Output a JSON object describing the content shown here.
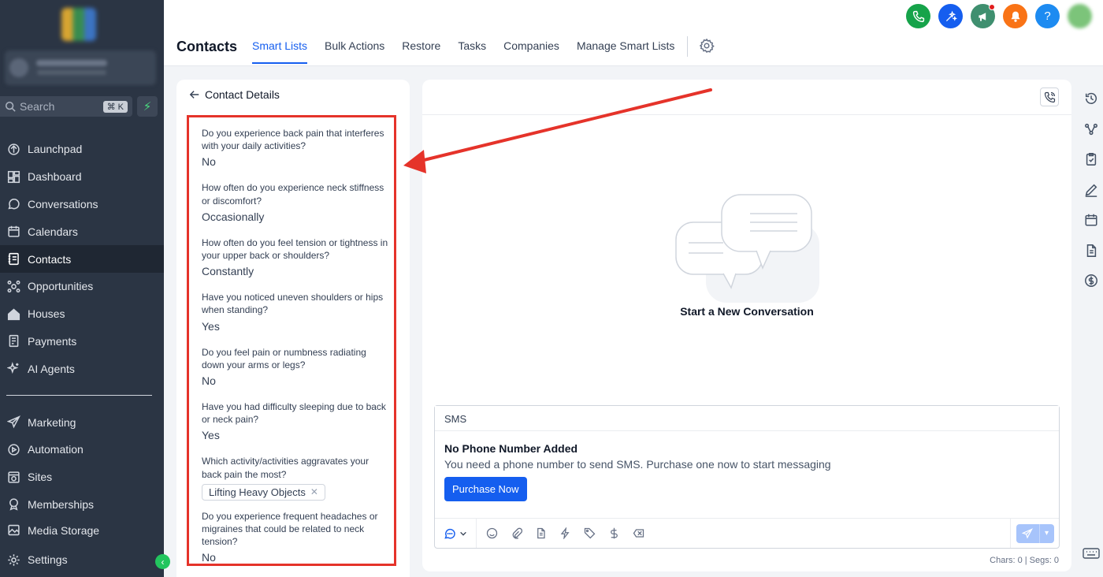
{
  "sidebar": {
    "search": {
      "placeholder": "Search",
      "shortcut": "⌘ K"
    },
    "items": [
      {
        "label": "Launchpad",
        "icon": "launchpad-icon"
      },
      {
        "label": "Dashboard",
        "icon": "dashboard-icon"
      },
      {
        "label": "Conversations",
        "icon": "chat-icon"
      },
      {
        "label": "Calendars",
        "icon": "calendar-icon"
      },
      {
        "label": "Contacts",
        "icon": "contacts-icon",
        "active": true
      },
      {
        "label": "Opportunities",
        "icon": "opportunities-icon"
      },
      {
        "label": "Houses",
        "icon": "house-icon"
      },
      {
        "label": "Payments",
        "icon": "payments-icon"
      },
      {
        "label": "AI Agents",
        "icon": "sparkle-icon"
      }
    ],
    "items2": [
      {
        "label": "Marketing",
        "icon": "send-icon"
      },
      {
        "label": "Automation",
        "icon": "automation-icon"
      },
      {
        "label": "Sites",
        "icon": "sites-icon"
      },
      {
        "label": "Memberships",
        "icon": "membership-icon"
      },
      {
        "label": "Media Storage",
        "icon": "media-icon"
      }
    ],
    "settings_label": "Settings"
  },
  "header": {
    "title": "Contacts",
    "tabs": [
      "Smart Lists",
      "Bulk Actions",
      "Restore",
      "Tasks",
      "Companies",
      "Manage Smart Lists"
    ],
    "active_tab": "Smart Lists",
    "top_icons": [
      {
        "name": "phone-icon",
        "color": "#16a34a"
      },
      {
        "name": "ai-sparkle-icon",
        "color": "#155eef"
      },
      {
        "name": "megaphone-icon",
        "color": "#3f8f6f"
      },
      {
        "name": "bell-icon",
        "color": "#f97316"
      },
      {
        "name": "help-icon",
        "color": "#1d8bf1",
        "glyph": "?"
      }
    ]
  },
  "details": {
    "title": "Contact Details",
    "fields": [
      {
        "q": "Do you experience back pain that interferes with your daily activities?",
        "a": "No"
      },
      {
        "q": "How often do you experience neck stiffness or discomfort?",
        "a": "Occasionally"
      },
      {
        "q": "How often do you feel tension or tightness in your upper back or shoulders?",
        "a": "Constantly"
      },
      {
        "q": "Have you noticed uneven shoulders or hips when standing?",
        "a": "Yes"
      },
      {
        "q": "Do you feel pain or numbness radiating down your arms or legs?",
        "a": "No"
      },
      {
        "q": "Have you had difficulty sleeping due to back or neck pain?",
        "a": "Yes"
      },
      {
        "q": "Which activity/activities aggravates your back pain the most?",
        "chip": "Lifting Heavy Objects"
      },
      {
        "q": "Do you experience frequent headaches or migraines that could be related to neck tension?",
        "a": "No"
      }
    ]
  },
  "conversation": {
    "empty_title": "Start a New Conversation",
    "channel_tab": "SMS",
    "warning_title": "No Phone Number Added",
    "warning_text": "You need a phone number to send SMS. Purchase one now to start messaging",
    "purchase_label": "Purchase Now",
    "counter": "Chars: 0 | Segs: 0"
  },
  "colors": {
    "accent": "#155eef",
    "sidebar": "#2b3544",
    "annotation": "#e5332a"
  }
}
